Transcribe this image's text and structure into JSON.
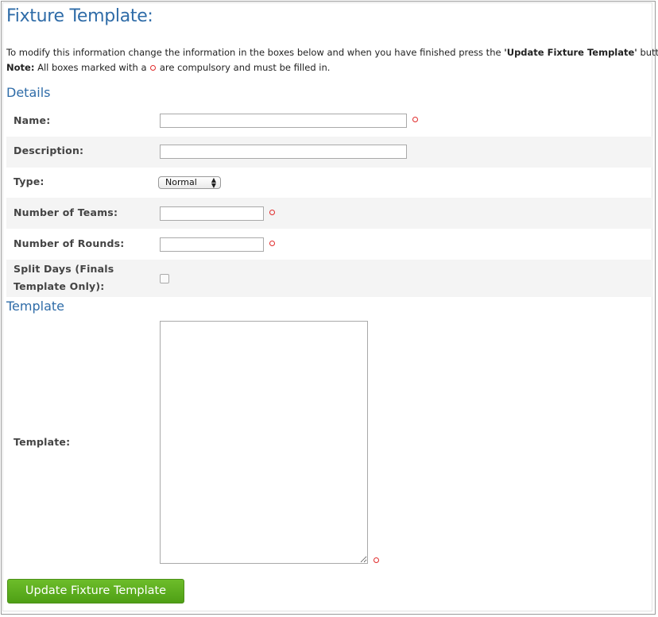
{
  "page": {
    "title": "Fixture Template:",
    "intro_text": "To modify this information change the information in the boxes below and when you have finished press the ",
    "intro_button_ref": "'Update Fixture Template'",
    "intro_suffix": " button.",
    "note_label": "Note:",
    "note_text_before": " All boxes marked with a ",
    "note_text_after": " are compulsory and must be filled in."
  },
  "details": {
    "heading": "Details",
    "name": {
      "label": "Name:",
      "value": "",
      "required": true
    },
    "description": {
      "label": "Description:",
      "value": ""
    },
    "type": {
      "label": "Type:",
      "selected": "Normal"
    },
    "teams": {
      "label": "Number of Teams:",
      "value": "",
      "required": true
    },
    "rounds": {
      "label": "Number of Rounds:",
      "value": "",
      "required": true
    },
    "split_days": {
      "label_line1": "Split Days (Finals",
      "label_line2": "Template Only):",
      "checked": false
    }
  },
  "template_section": {
    "heading": "Template",
    "label": "Template:",
    "value": "",
    "required": true
  },
  "actions": {
    "submit_label": "Update Fixture Template"
  },
  "colors": {
    "heading": "#2f6ca8",
    "required_icon": "#e02a2a",
    "button": "#5aad1f"
  }
}
